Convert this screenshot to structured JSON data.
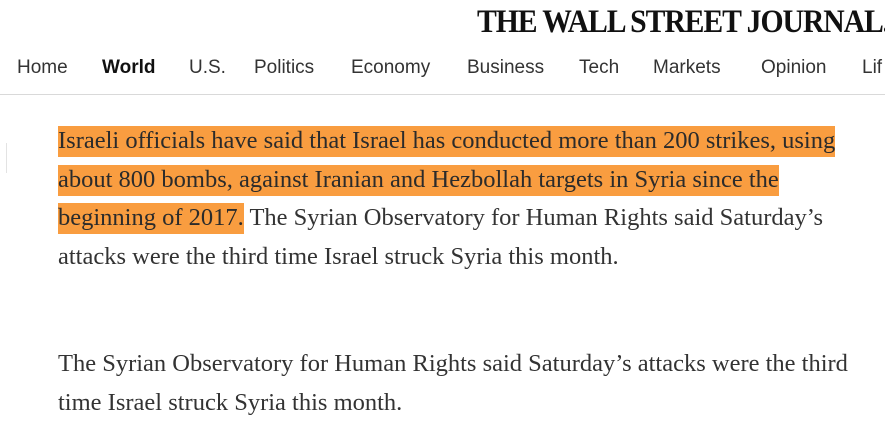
{
  "masthead": {
    "title": "THE WALL STREET JOURNAL."
  },
  "nav": {
    "items": [
      {
        "label": "Home",
        "active": false
      },
      {
        "label": "World",
        "active": true
      },
      {
        "label": "U.S.",
        "active": false
      },
      {
        "label": "Politics",
        "active": false
      },
      {
        "label": "Economy",
        "active": false
      },
      {
        "label": "Business",
        "active": false
      },
      {
        "label": "Tech",
        "active": false
      },
      {
        "label": "Markets",
        "active": false
      },
      {
        "label": "Opinion",
        "active": false
      },
      {
        "label": "Lif",
        "active": false
      }
    ]
  },
  "article": {
    "paragraph1": {
      "highlighted": "Israeli officials have said that Israel has conducted more than 200 strikes, using about 800 bombs, against Iranian and Hezbollah targets in Syria since the beginning of 2017.",
      "rest": " The Syrian Observatory for Human Rights said Saturday’s attacks were the third time Israel struck Syria this month."
    },
    "paragraph2": "The Syrian Observatory for Human Rights said Saturday’s attacks were the third time Israel struck Syria this month."
  },
  "colors": {
    "highlight": "#f99d40",
    "text": "#333333",
    "divider": "#d9d9d9"
  }
}
